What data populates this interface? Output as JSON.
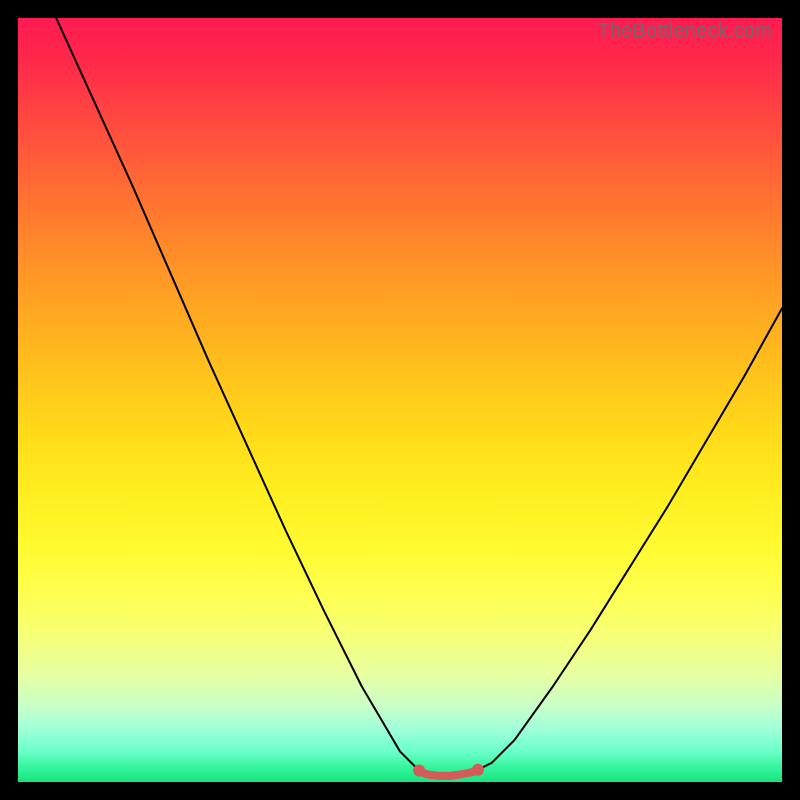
{
  "watermark": "TheBottleneck.com",
  "chart_data": {
    "type": "line",
    "title": "",
    "xlabel": "",
    "ylabel": "",
    "xlim": [
      0,
      100
    ],
    "ylim": [
      0,
      100
    ],
    "grid": false,
    "legend": false,
    "background": "heat-gradient",
    "series": [
      {
        "name": "curve-left",
        "x": [
          5,
          10,
          15,
          20,
          25,
          30,
          35,
          40,
          45,
          50,
          52.5
        ],
        "values": [
          100,
          89,
          78,
          66.5,
          55,
          44,
          33,
          22.5,
          12.5,
          4,
          1.5
        ],
        "color": "#000000",
        "style": "line"
      },
      {
        "name": "curve-right",
        "x": [
          60,
          62,
          65,
          70,
          75,
          80,
          85,
          90,
          95,
          100
        ],
        "values": [
          1.5,
          2.5,
          5.5,
          12.5,
          20,
          28,
          36,
          44.5,
          53,
          62
        ],
        "color": "#000000",
        "style": "line"
      },
      {
        "name": "minimum-marker",
        "x": [
          52.5,
          53.5,
          55,
          56.5,
          58,
          59.5,
          60.2
        ],
        "values": [
          1.5,
          1.0,
          0.8,
          0.8,
          1.0,
          1.3,
          1.6
        ],
        "color": "#d55a5a",
        "style": "thick-with-endpoints"
      }
    ]
  }
}
